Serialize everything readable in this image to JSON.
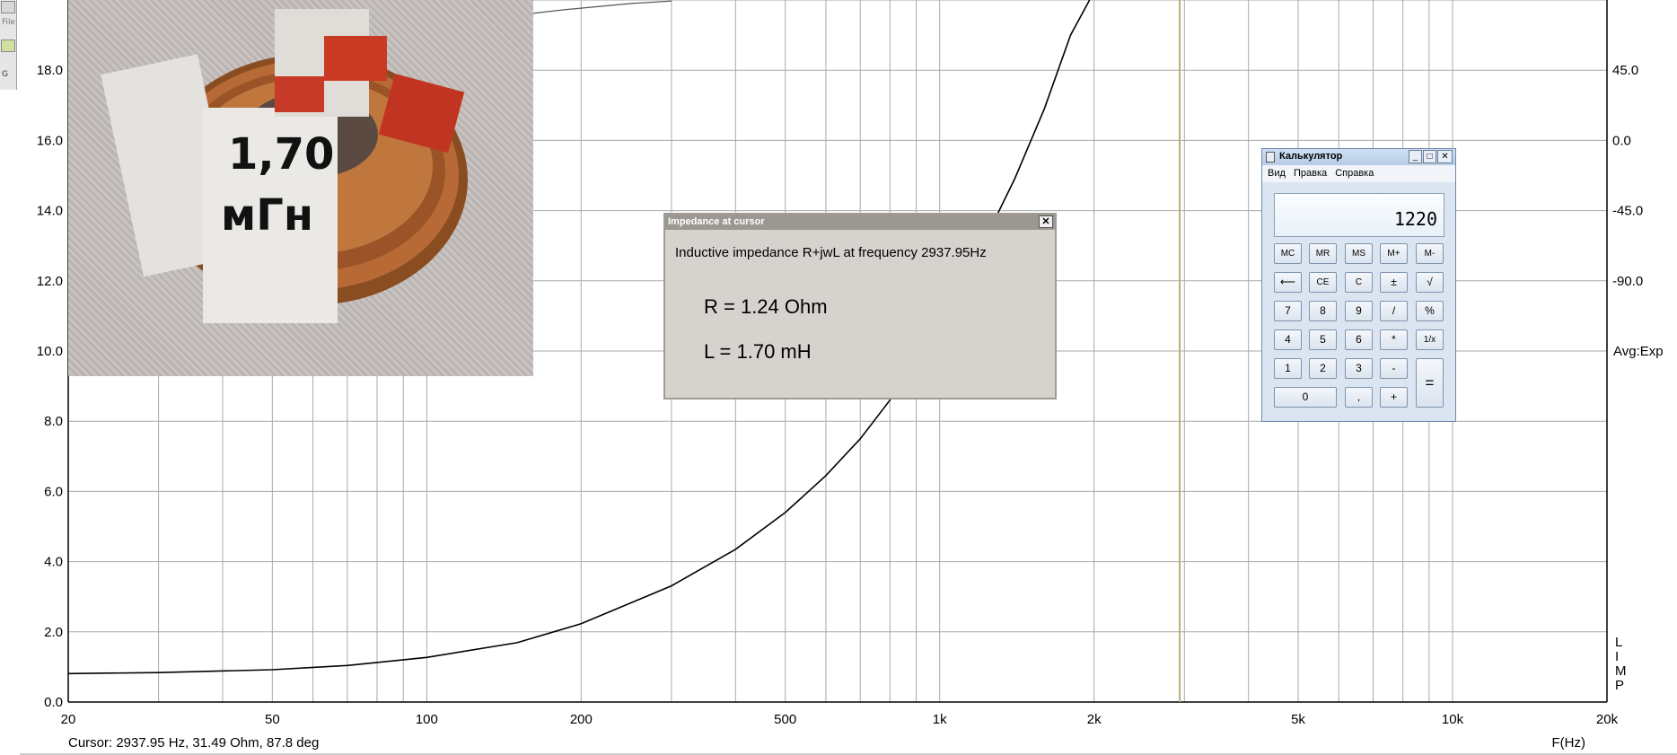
{
  "left_toolbar": {
    "menu_file_fragment": "File",
    "button_g_fragment": "G"
  },
  "chart_data": {
    "type": "line",
    "x_scale": "log",
    "xlim": [
      20,
      20000
    ],
    "ylim_left": [
      0.0,
      20.0
    ],
    "x_ticks": [
      {
        "v": 20,
        "label": "20"
      },
      {
        "v": 50,
        "label": "50"
      },
      {
        "v": 100,
        "label": "100"
      },
      {
        "v": 200,
        "label": "200"
      },
      {
        "v": 500,
        "label": "500"
      },
      {
        "v": 1000,
        "label": "1k"
      },
      {
        "v": 2000,
        "label": "2k"
      },
      {
        "v": 5000,
        "label": "5k"
      },
      {
        "v": 10000,
        "label": "10k"
      },
      {
        "v": 20000,
        "label": "20k"
      }
    ],
    "y_ticks_left": [
      "0.0",
      "2.0",
      "4.0",
      "6.0",
      "8.0",
      "10.0",
      "12.0",
      "14.0",
      "16.0",
      "18.0"
    ],
    "y_ticks_right": [
      {
        "at_left_value": 18.0,
        "label": "45.0"
      },
      {
        "at_left_value": 16.0,
        "label": "0.0"
      },
      {
        "at_left_value": 14.0,
        "label": "-45.0"
      },
      {
        "at_left_value": 12.0,
        "label": "-90.0"
      }
    ],
    "x_axis_label": "F(Hz)",
    "right_note": "Avg:Exp",
    "right_vertical_label": [
      "L",
      "I",
      "M",
      "P"
    ],
    "cursor_frequency": 2937.95,
    "cursor_readout": "Cursor: 2937.95 Hz, 31.49 Ohm, 87.8 deg",
    "series": [
      {
        "kind": "impedance-magnitude",
        "color": "#000000",
        "points": [
          [
            20,
            0.81
          ],
          [
            30,
            0.84
          ],
          [
            50,
            0.92
          ],
          [
            70,
            1.04
          ],
          [
            100,
            1.27
          ],
          [
            150,
            1.69
          ],
          [
            200,
            2.23
          ],
          [
            300,
            3.31
          ],
          [
            400,
            4.35
          ],
          [
            500,
            5.4
          ],
          [
            600,
            6.45
          ],
          [
            700,
            7.5
          ],
          [
            800,
            8.6
          ],
          [
            900,
            9.7
          ],
          [
            1000,
            10.8
          ],
          [
            1200,
            12.9
          ],
          [
            1400,
            14.9
          ],
          [
            1600,
            16.9
          ],
          [
            1800,
            19.0
          ],
          [
            1960,
            20.0
          ]
        ]
      },
      {
        "kind": "phase-fragment",
        "color": "#555555",
        "points": [
          [
            136,
            19.5
          ],
          [
            185,
            19.72
          ],
          [
            250,
            19.9
          ],
          [
            300,
            19.97
          ]
        ]
      }
    ],
    "colors": {
      "grid": "#aaaaaa",
      "curve": "#000000",
      "cursor": "#b8ae77"
    }
  },
  "impedance_dialog": {
    "title": "Impedance at cursor",
    "close_glyph": "✕",
    "description": "Inductive impedance R+jwL at frequency 2937.95Hz",
    "resistance": "R = 1.24 Ohm",
    "inductance": "L = 1.70 mH"
  },
  "calculator": {
    "title": "Калькулятор",
    "menu": [
      "Вид",
      "Правка",
      "Справка"
    ],
    "display": "1220",
    "window_buttons": [
      "_",
      "□",
      "✕"
    ],
    "keys": {
      "mc": "MC",
      "mr": "MR",
      "ms": "MS",
      "mplus": "M+",
      "mminus": "M-",
      "backspace": "⟵",
      "ce": "CE",
      "c": "C",
      "plusminus": "±",
      "sqrt": "√",
      "k7": "7",
      "k8": "8",
      "k9": "9",
      "div": "/",
      "percent": "%",
      "k4": "4",
      "k5": "5",
      "k6": "6",
      "mul": "*",
      "recip": "1/x",
      "k1": "1",
      "k2": "2",
      "k3": "3",
      "minus": "-",
      "k0": "0",
      "dot": ",",
      "plus": "+",
      "equals": "="
    }
  },
  "photo": {
    "subject": "inductor-coil",
    "label_line1": "1,70",
    "label_line2": "мГн"
  }
}
